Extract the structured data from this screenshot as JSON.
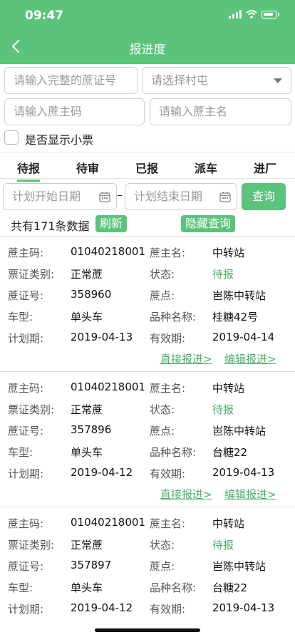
{
  "status_bar": {
    "time": "09:47"
  },
  "header": {
    "title": "报进度"
  },
  "search": {
    "cane_cert_placeholder": "请输入完整的蔗证号",
    "village_placeholder": "请选择村屯",
    "owner_code_placeholder": "请输入蔗主码",
    "owner_name_placeholder": "请输入蔗主名",
    "show_ticket_label": "是否显示小票"
  },
  "tabs": [
    {
      "label": "待报",
      "active": true
    },
    {
      "label": "待审"
    },
    {
      "label": "已报"
    },
    {
      "label": "派车"
    },
    {
      "label": "进厂"
    }
  ],
  "date_filter": {
    "start_placeholder": "计划开始日期",
    "end_placeholder": "计划结束日期",
    "separator": "–",
    "query_label": "查询"
  },
  "summary": {
    "count_text": "共有171条数据",
    "refresh_label": "刷新",
    "hide_query_label": "隐藏查询"
  },
  "labels": {
    "owner_code": "蔗主码:",
    "owner_name": "蔗主名:",
    "ticket_type": "票证类别:",
    "status": "状态:",
    "cert_no": "蔗证号:",
    "point": "蔗点:",
    "vehicle": "车型:",
    "variety": "品种名称:",
    "plan_date": "计划期:",
    "valid_date": "有效期:"
  },
  "records": [
    {
      "owner_code": "01040218001",
      "owner_name": "中转站",
      "ticket_type": "正常蔗",
      "status": "待报",
      "cert_no": "358960",
      "point": "岜陈中转站",
      "vehicle": "单头车",
      "variety": "桂糖42号",
      "plan_date": "2019-04-13",
      "valid_date": "2019-04-14",
      "action_report": "直接报进>",
      "action_edit": "编辑报进>"
    },
    {
      "owner_code": "01040218001",
      "owner_name": "中转站",
      "ticket_type": "正常蔗",
      "status": "待报",
      "cert_no": "357896",
      "point": "岜陈中转站",
      "vehicle": "单头车",
      "variety": "台糖22",
      "plan_date": "2019-04-12",
      "valid_date": "2019-04-13",
      "action_report": "直接报进>",
      "action_edit": "编辑报进>"
    },
    {
      "owner_code": "01040218001",
      "owner_name": "中转站",
      "ticket_type": "正常蔗",
      "status": "待报",
      "cert_no": "357897",
      "point": "岜陈中转站",
      "vehicle": "单头车",
      "variety": "台糖22",
      "plan_date": "2019-04-12",
      "valid_date": "2019-04-13"
    }
  ],
  "colors": {
    "accent": "#5bc37b",
    "status_green": "#4caf6a"
  }
}
